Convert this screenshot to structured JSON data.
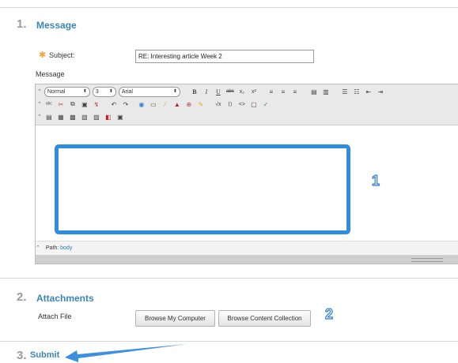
{
  "section1": {
    "number": "1.",
    "title": "Message"
  },
  "subject": {
    "required_mark": "✱",
    "label": "Subject:",
    "value": "RE: Interesting article Week 2"
  },
  "message_label": "Message",
  "toolbar": {
    "format": "Normal",
    "size": "3",
    "font": "Arial",
    "bold": "B",
    "italic": "I",
    "underline": "U",
    "strike": "abc",
    "subscript": "x₂",
    "superscript": "x²"
  },
  "path": {
    "label": "Path:",
    "value": "body"
  },
  "callouts": {
    "editor": "1",
    "attachments": "2"
  },
  "section2": {
    "number": "2.",
    "title": "Attachments"
  },
  "attach_label": "Attach File",
  "buttons": {
    "browse_computer": "Browse My Computer",
    "browse_collection": "Browse Content Collection"
  },
  "section3": {
    "number": "3.",
    "title": "Submit"
  },
  "colors": {
    "accent": "#3a86b8",
    "highlight": "#2f8de4",
    "required": "#f2a23a"
  }
}
